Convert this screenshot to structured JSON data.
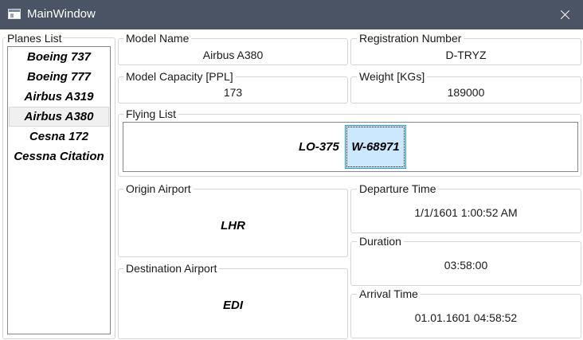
{
  "window": {
    "title": "MainWindow"
  },
  "planes_list": {
    "label": "Planes List",
    "items": [
      "Boeing 737",
      "Boeing 777",
      "Airbus A319",
      "Airbus A380",
      "Cesna 172",
      "Cessna Citation"
    ],
    "selected": "Airbus A380"
  },
  "model_name": {
    "label": "Model Name",
    "value": "Airbus A380"
  },
  "registration": {
    "label": "Registration Number",
    "value": "D-TRYZ"
  },
  "capacity": {
    "label": "Model Capacity [PPL]",
    "value": "173"
  },
  "weight": {
    "label": "Weight [KGs]",
    "value": "189000"
  },
  "flying_list": {
    "label": "Flying List",
    "items": [
      "LO-375",
      "W-68971"
    ],
    "selected": "W-68971"
  },
  "origin": {
    "label": "Origin Airport",
    "value": "LHR"
  },
  "destination": {
    "label": "Destination Airport",
    "value": "EDI"
  },
  "departure": {
    "label": "Departure Time",
    "value": "1/1/1601 1:00:52 AM"
  },
  "duration": {
    "label": "Duration",
    "value": "03:58:00"
  },
  "arrival": {
    "label": "Arrival Time",
    "value": "01.01.1601 04:58:52"
  }
}
